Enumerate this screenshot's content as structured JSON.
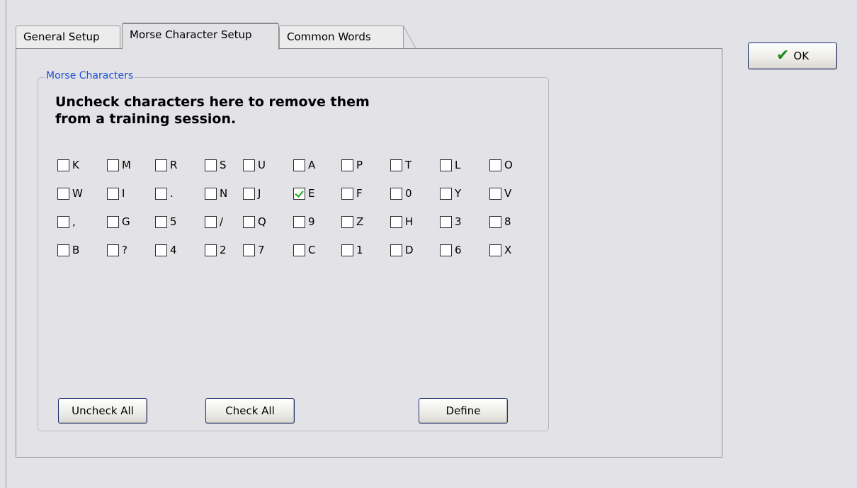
{
  "tabs": [
    {
      "label": "General Setup",
      "active": false
    },
    {
      "label": "Morse Character Setup",
      "active": true
    },
    {
      "label": "Common Words",
      "active": false
    }
  ],
  "group": {
    "title": "Morse Characters",
    "instruction_line1": "Uncheck characters here to remove them",
    "instruction_line2": "from a training session."
  },
  "characters": [
    [
      {
        "c": "K",
        "checked": false
      },
      {
        "c": "M",
        "checked": false
      },
      {
        "c": "R",
        "checked": false
      },
      {
        "c": "S",
        "checked": false
      },
      {
        "c": "U",
        "checked": false
      },
      {
        "c": "A",
        "checked": false
      },
      {
        "c": "P",
        "checked": false
      },
      {
        "c": "T",
        "checked": false
      },
      {
        "c": "L",
        "checked": false
      },
      {
        "c": "O",
        "checked": false
      }
    ],
    [
      {
        "c": "W",
        "checked": false
      },
      {
        "c": "I",
        "checked": false
      },
      {
        "c": ".",
        "checked": false
      },
      {
        "c": "N",
        "checked": false
      },
      {
        "c": "J",
        "checked": false
      },
      {
        "c": "E",
        "checked": true
      },
      {
        "c": "F",
        "checked": false
      },
      {
        "c": "0",
        "checked": false
      },
      {
        "c": "Y",
        "checked": false
      },
      {
        "c": "V",
        "checked": false
      }
    ],
    [
      {
        "c": ",",
        "checked": false
      },
      {
        "c": "G",
        "checked": false
      },
      {
        "c": "5",
        "checked": false
      },
      {
        "c": "/",
        "checked": false
      },
      {
        "c": "Q",
        "checked": false
      },
      {
        "c": "9",
        "checked": false
      },
      {
        "c": "Z",
        "checked": false
      },
      {
        "c": "H",
        "checked": false
      },
      {
        "c": "3",
        "checked": false
      },
      {
        "c": "8",
        "checked": false
      }
    ],
    [
      {
        "c": "B",
        "checked": false
      },
      {
        "c": "?",
        "checked": false
      },
      {
        "c": "4",
        "checked": false
      },
      {
        "c": "2",
        "checked": false
      },
      {
        "c": "7",
        "checked": false
      },
      {
        "c": "C",
        "checked": false
      },
      {
        "c": "1",
        "checked": false
      },
      {
        "c": "D",
        "checked": false
      },
      {
        "c": "6",
        "checked": false
      },
      {
        "c": "X",
        "checked": false
      }
    ]
  ],
  "buttons": {
    "uncheck_all": "Uncheck All",
    "check_all": "Check All",
    "define": "Define",
    "ok": "OK"
  },
  "icons": {
    "ok": "checkmark-icon"
  },
  "colors": {
    "group_title": "#1c4fd8",
    "checkmark": "#1aa51a"
  }
}
